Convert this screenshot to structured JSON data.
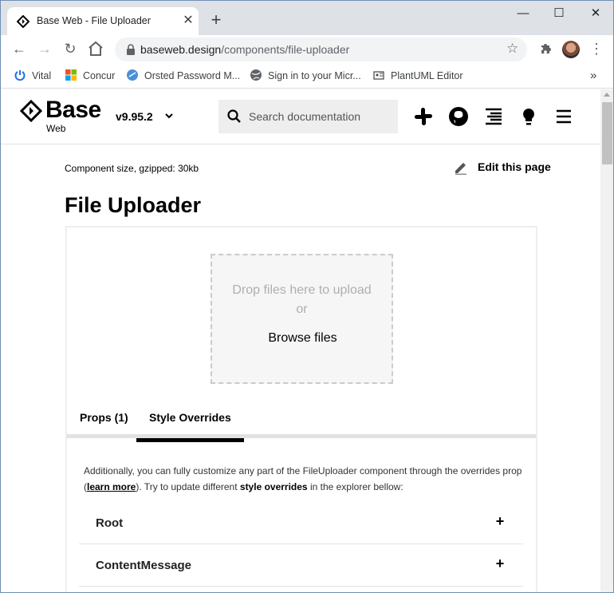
{
  "browser": {
    "tab_title": "Base Web - File Uploader",
    "url_host": "baseweb.design",
    "url_path": "/components/file-uploader",
    "bookmarks": [
      {
        "label": "Vital",
        "icon": "power-icon"
      },
      {
        "label": "Concur",
        "icon": "windows-icon"
      },
      {
        "label": "Orsted Password M...",
        "icon": "password-icon"
      },
      {
        "label": "Sign in to your Micr...",
        "icon": "globe-icon"
      },
      {
        "label": "PlantUML Editor",
        "icon": "plantuml-icon"
      }
    ]
  },
  "site": {
    "logo": "Base",
    "logo_sub": "Web",
    "version": "v9.95.2",
    "search_placeholder": "Search documentation"
  },
  "page": {
    "component_size": "Component size, gzipped: 30kb",
    "edit_label": "Edit this page",
    "title": "File Uploader",
    "dropzone": {
      "message": "Drop files here to upload",
      "or": "or",
      "browse": "Browse files"
    },
    "tabs": [
      {
        "label": "Props (1)",
        "active": false
      },
      {
        "label": "Style Overrides",
        "active": true
      }
    ],
    "description": {
      "part1": "Additionally, you can fully customize any part of the FileUploader component through the overrides prop (",
      "link": "learn more",
      "part2": "). Try to update different ",
      "bold": "style overrides",
      "part3": " in the explorer bellow:"
    },
    "overrides": [
      "Root",
      "ContentMessage"
    ]
  },
  "colors": {
    "accent": "#000000",
    "tab_underline": "#000000",
    "dropzone_bg": "#f6f6f6"
  }
}
